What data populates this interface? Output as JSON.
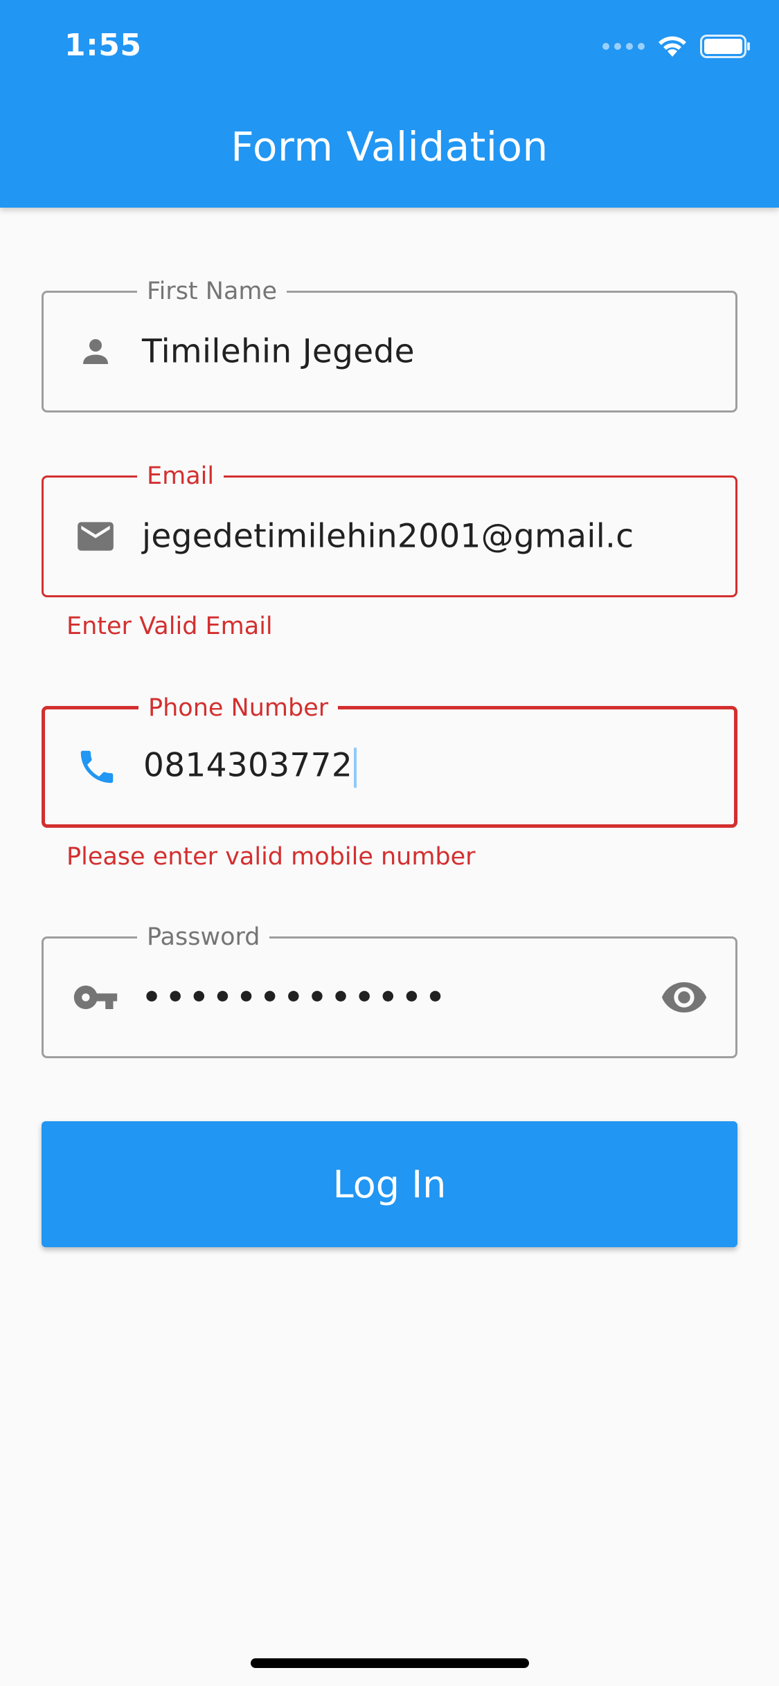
{
  "status_bar": {
    "time": "1:55",
    "icons": [
      "signal-icon",
      "wifi-icon",
      "battery-icon"
    ]
  },
  "app_bar": {
    "title": "Form Validation",
    "color": "#2196f3"
  },
  "form": {
    "first_name": {
      "label": "First Name",
      "value": "Timilehin Jegede",
      "icon": "person-icon"
    },
    "email": {
      "label": "Email",
      "value": "jegedetimilehin2001@gmail.c",
      "icon": "email-icon",
      "error": "Enter Valid Email"
    },
    "phone": {
      "label": "Phone Number",
      "value": "0814303772",
      "icon": "phone-icon",
      "error": "Please enter valid mobile number"
    },
    "password": {
      "label": "Password",
      "value": "•••••••••••••",
      "icon": "key-icon",
      "trailing_icon": "eye-icon"
    }
  },
  "login_button": {
    "label": "Log In"
  },
  "colors": {
    "primary": "#2196f3",
    "error": "#d32f2f",
    "border": "#9e9e9e",
    "icon_gray": "#757575"
  }
}
